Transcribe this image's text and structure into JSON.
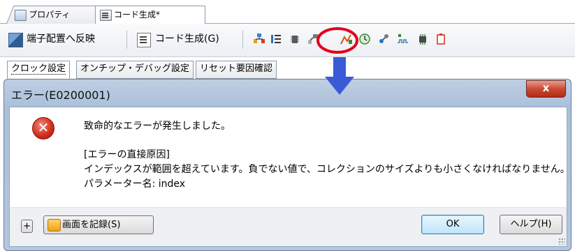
{
  "doc_tabs": [
    {
      "label": "プロパティ",
      "icon": "properties-icon",
      "active": false
    },
    {
      "label": "コード生成*",
      "icon": "code-generation-icon",
      "active": true
    }
  ],
  "toolbar": {
    "reflect_label": "端子配置へ反映",
    "codegen_label": "コード生成(G)",
    "icons": [
      "pin-layout-icon",
      "pin-list-icon",
      "device-icon",
      "link-icon",
      "chart-icon",
      "clock-icon",
      "network-icon",
      "waveform-icon",
      "memory-icon",
      "clipboard-icon"
    ]
  },
  "sub_tabs": [
    {
      "label": "クロック設定",
      "active": true
    },
    {
      "label": "オンチップ・デバッグ設定",
      "active": false
    },
    {
      "label": "リセット要因確認",
      "active": false
    }
  ],
  "dialog": {
    "title": "エラー(E0200001)",
    "close_label": "x",
    "message_lines": [
      "致命的なエラーが発生しました。",
      "[エラーの直接原因]",
      "インデックスが範囲を超えています。負でない値で、コレクションのサイズよりも小さくなければなりません。",
      "パラメーター名: index"
    ],
    "expand_label": "+",
    "record_label": "画面を記録(S)",
    "ok_label": "OK",
    "help_label": "ヘルプ(H)"
  },
  "colors": {
    "highlight_circle": "#e3001b",
    "arrow": "#3b5bd6",
    "dialog_frame": "#aac0da"
  }
}
